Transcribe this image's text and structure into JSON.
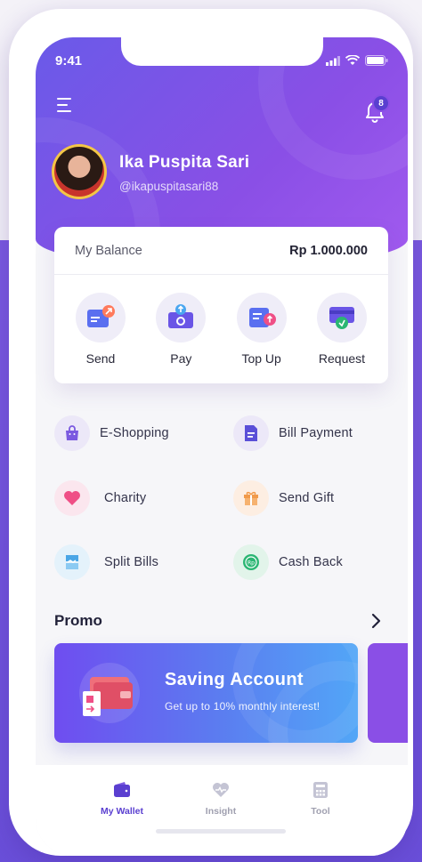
{
  "status_bar": {
    "time": "9:41"
  },
  "header": {
    "notification_count": "8",
    "user_name": "Ika Puspita Sari",
    "user_handle": "@ikapuspitasari88"
  },
  "balance": {
    "label": "My Balance",
    "value": "Rp 1.000.000"
  },
  "actions": [
    {
      "label": "Send",
      "icon": "send-icon"
    },
    {
      "label": "Pay",
      "icon": "pay-icon"
    },
    {
      "label": "Top Up",
      "icon": "top-up-icon"
    },
    {
      "label": "Request",
      "icon": "request-icon"
    }
  ],
  "services": [
    {
      "label": "E-Shopping",
      "icon": "shopping-bag-icon",
      "color": "#7b5ae0"
    },
    {
      "label": "Bill Payment",
      "icon": "bill-icon",
      "color": "#5a4fd8"
    },
    {
      "label": "Charity",
      "icon": "heart-icon",
      "color": "#ef4f86"
    },
    {
      "label": "Send Gift",
      "icon": "gift-icon",
      "color": "#f19a4a"
    },
    {
      "label": "Split Bills",
      "icon": "split-bill-icon",
      "color": "#4aa6e6"
    },
    {
      "label": "Cash Back",
      "icon": "cashback-icon",
      "color": "#2bb673"
    }
  ],
  "promo": {
    "title": "Promo",
    "card_heading": "Saving Account",
    "card_subtitle": "Get up to 10% monthly interest!"
  },
  "tabs": [
    {
      "label": "My Wallet",
      "icon": "wallet-icon",
      "active": true
    },
    {
      "label": "Insight",
      "icon": "heart-pulse-icon",
      "active": false
    },
    {
      "label": "Tool",
      "icon": "calculator-icon",
      "active": false
    }
  ],
  "colors": {
    "accent": "#5a3fd0",
    "header_gradient_start": "#6a5ae8",
    "header_gradient_end": "#a25bef"
  }
}
